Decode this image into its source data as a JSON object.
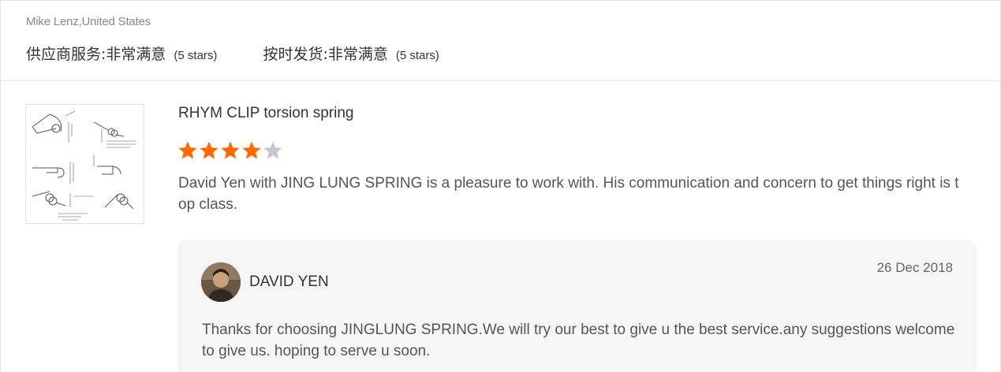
{
  "review": {
    "reviewer": "Mike Lenz,United States",
    "ratings": [
      {
        "label": "供应商服务: ",
        "value": "非常满意",
        "stars": "(5 stars)"
      },
      {
        "label": "按时发货: ",
        "value": "非常满意",
        "stars": "(5 stars)"
      }
    ],
    "product": {
      "title": "RHYM CLIP torsion spring",
      "image_icon": "spring-drawing-thumbnail"
    },
    "rating_stars": 4,
    "rating_max": 5,
    "star_colors": {
      "filled": "#ff6a00",
      "empty": "#c4c8d0"
    },
    "text": "David Yen with JING LUNG SPRING is a pleasure to work with. His communication and concern to get things right is top class."
  },
  "reply": {
    "author": "DAVID YEN",
    "date": "26 Dec 2018",
    "text": "Thanks for choosing JINGLUNG SPRING.We will try our best to give u the best service.any suggestions welcome to give us. hoping to serve u soon.",
    "avatar_icon": "user-avatar"
  }
}
